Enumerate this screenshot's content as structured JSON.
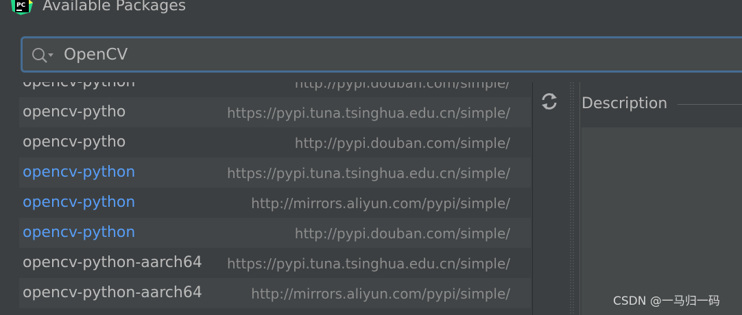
{
  "window": {
    "title": "Available Packages",
    "app_icon_text": "PC"
  },
  "search": {
    "value": "OpenCV",
    "icon": "search-icon"
  },
  "packages": [
    {
      "name": "opencv-python",
      "repo": "http://pypi.douban.com/simple/",
      "installed": false
    },
    {
      "name": "opencv-pytho",
      "repo": "https://pypi.tuna.tsinghua.edu.cn/simple/",
      "installed": false
    },
    {
      "name": "opencv-pytho",
      "repo": "http://pypi.douban.com/simple/",
      "installed": false
    },
    {
      "name": "opencv-python",
      "repo": "https://pypi.tuna.tsinghua.edu.cn/simple/",
      "installed": true
    },
    {
      "name": "opencv-python",
      "repo": "http://mirrors.aliyun.com/pypi/simple/",
      "installed": true
    },
    {
      "name": "opencv-python",
      "repo": "http://pypi.douban.com/simple/",
      "installed": true
    },
    {
      "name": "opencv-python-aarch64",
      "repo": "https://pypi.tuna.tsinghua.edu.cn/simple/",
      "installed": false
    },
    {
      "name": "opencv-python-aarch64",
      "repo": "http://mirrors.aliyun.com/pypi/simple/",
      "installed": false
    }
  ],
  "toolbar": {
    "refresh_icon": "refresh-icon"
  },
  "details": {
    "description_label": "Description"
  },
  "watermark": "CSDN @一马归一码",
  "colors": {
    "background": "#3c3f41",
    "installed_package": "#589df6",
    "focus_border": "#466d94",
    "text": "#bbbbbb",
    "repo_text": "#8c8c8c"
  }
}
